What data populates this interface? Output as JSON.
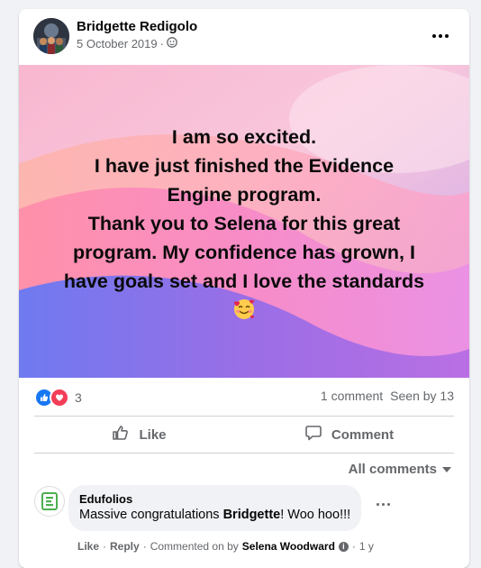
{
  "post": {
    "author": "Bridgette Redigolo",
    "date": "5 October 2019",
    "separator": "·",
    "privacy_icon": "friends-icon",
    "text_lines": [
      "I am so excited.",
      "I have just finished the Evidence",
      "Engine program.",
      "Thank you to Selena for this great",
      "program. My confidence has grown, I",
      "have goals set and I love the standards"
    ],
    "emoji": "smiling-face-with-hearts"
  },
  "stats": {
    "reaction_icons": [
      "like-icon",
      "love-icon"
    ],
    "reaction_count": "3",
    "comments": "1 comment",
    "seen": "Seen by 13"
  },
  "actions": {
    "like_label": "Like",
    "comment_label": "Comment"
  },
  "filter": {
    "label": "All comments"
  },
  "comment": {
    "author": "Edufolios",
    "text_before": "Massive congratulations ",
    "text_bold": "Bridgette",
    "text_after": "! Woo hoo!!!",
    "like": "Like",
    "dot1": "·",
    "reply": "Reply",
    "dot2": "·",
    "commented_on_by": "Commented on by",
    "commenter": "Selena Woodward",
    "time": "1 y",
    "dot3": "·"
  },
  "colors": {
    "like_blue": "#1877f2",
    "love_red": "#f33e58",
    "muted": "#65676b",
    "edufolios_green": "#4caf50"
  }
}
